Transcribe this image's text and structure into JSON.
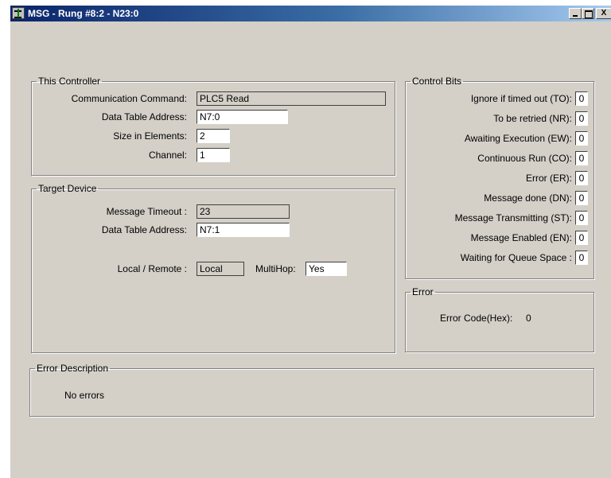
{
  "window": {
    "title": "MSG - Rung #8:2 - N23:0",
    "minimize_label": "_",
    "maximize_label": "",
    "close_label": "X"
  },
  "this_controller": {
    "legend": "This Controller",
    "communication_command_label": "Communication Command:",
    "communication_command_value": "PLC5 Read",
    "data_table_address_label": "Data Table Address:",
    "data_table_address_value": "N7:0",
    "size_in_elements_label": "Size in Elements:",
    "size_in_elements_value": "2",
    "channel_label": "Channel:",
    "channel_value": "1"
  },
  "target_device": {
    "legend": "Target Device",
    "message_timeout_label": "Message Timeout :",
    "message_timeout_value": "23",
    "data_table_address_label": "Data Table Address:",
    "data_table_address_value": "N7:1",
    "local_remote_label": "Local / Remote :",
    "local_remote_value": "Local",
    "multihop_label": "MultiHop:",
    "multihop_value": "Yes"
  },
  "control_bits": {
    "legend": "Control Bits",
    "items": [
      {
        "label": "Ignore if timed out (TO):",
        "value": "0"
      },
      {
        "label": "To be retried (NR):",
        "value": "0"
      },
      {
        "label": "Awaiting Execution (EW):",
        "value": "0"
      },
      {
        "label": "Continuous Run (CO):",
        "value": "0"
      },
      {
        "label": "Error (ER):",
        "value": "0"
      },
      {
        "label": "Message done (DN):",
        "value": "0"
      },
      {
        "label": "Message Transmitting (ST):",
        "value": "0"
      },
      {
        "label": "Message Enabled (EN):",
        "value": "0"
      },
      {
        "label": "Waiting for Queue Space :",
        "value": "0"
      }
    ]
  },
  "error": {
    "legend": "Error",
    "code_label": "Error Code(Hex):",
    "code_value": "0"
  },
  "error_description": {
    "legend": "Error Description",
    "text": "No errors"
  }
}
